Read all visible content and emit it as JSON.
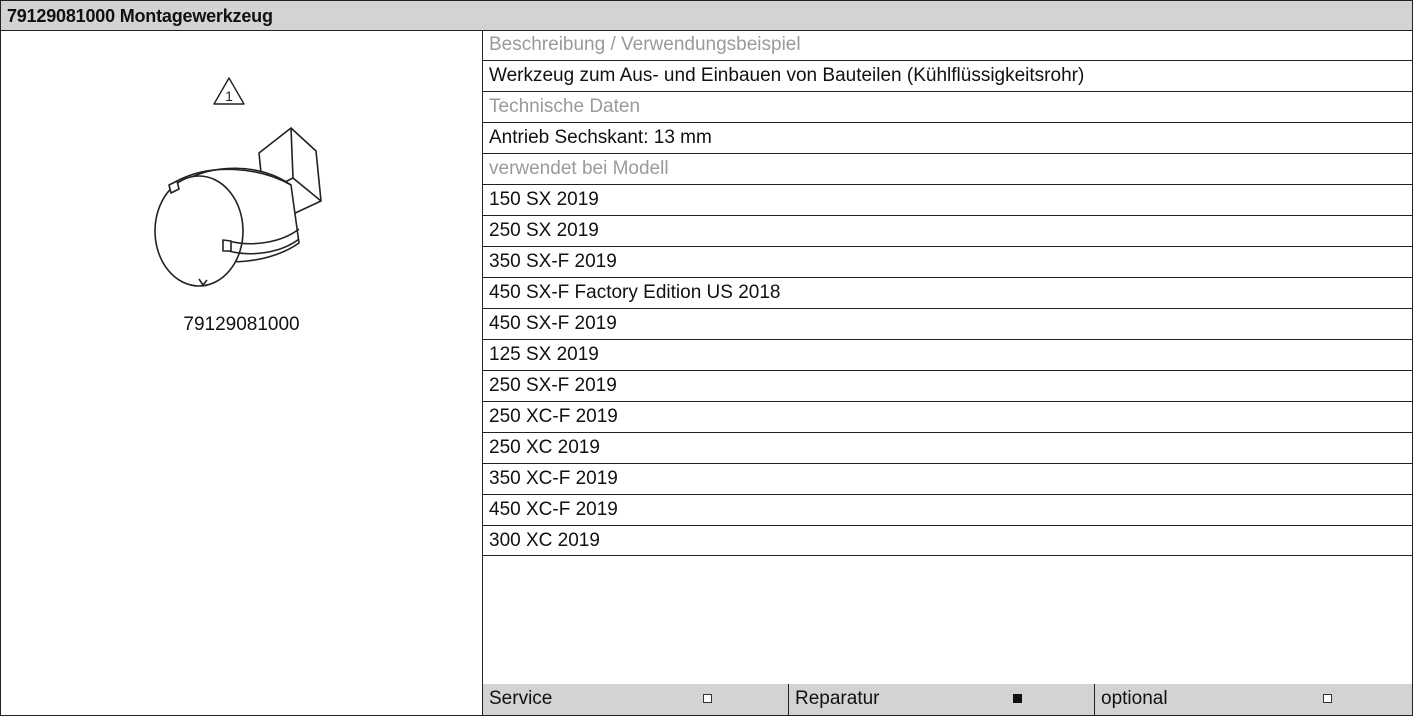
{
  "header": {
    "title": "79129081000 Montagewerkzeug"
  },
  "image": {
    "part_number": "79129081000",
    "warning_icon": "warning-triangle-1-icon",
    "tool_icon": "mounting-tool-drawing"
  },
  "details": {
    "description_label": "Beschreibung / Verwendungsbeispiel",
    "description": "Werkzeug zum Aus- und Einbauen von Bauteilen (Kühlflüssigkeitsrohr)",
    "tech_label": "Technische Daten",
    "tech_value": "Antrieb Sechskant: 13 mm",
    "models_label": "verwendet bei Modell",
    "models": [
      "150 SX 2019",
      "250 SX 2019",
      "350 SX-F 2019",
      "450 SX-F Factory Edition US 2018",
      "450 SX-F 2019",
      "125 SX 2019",
      "250 SX-F 2019",
      "250 XC-F 2019",
      "250 XC 2019",
      "350 XC-F 2019",
      "450 XC-F 2019",
      "300 XC 2019"
    ]
  },
  "footer": [
    {
      "label": "Service",
      "checked": false
    },
    {
      "label": "Reparatur",
      "checked": true
    },
    {
      "label": "optional",
      "checked": false
    }
  ]
}
